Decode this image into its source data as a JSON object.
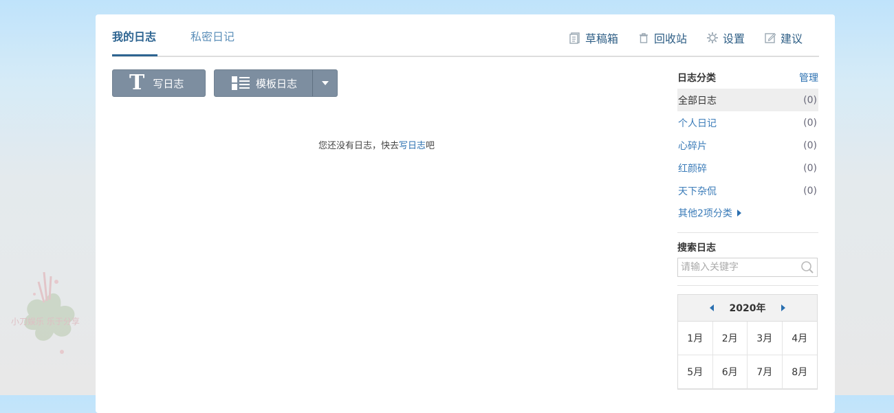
{
  "tabs": [
    {
      "label": "我的日志",
      "active": true
    },
    {
      "label": "私密日记",
      "active": false
    }
  ],
  "top_links": [
    {
      "label": "草稿箱",
      "icon": "draft-icon"
    },
    {
      "label": "回收站",
      "icon": "trash-icon"
    },
    {
      "label": "设置",
      "icon": "gear-icon"
    },
    {
      "label": "建议",
      "icon": "edit-icon"
    }
  ],
  "buttons": {
    "write_label": "写日志",
    "write_icon_glyph": "T",
    "template_label": "模板日志"
  },
  "empty": {
    "prefix": "您还没有日志，快去",
    "link": "写日志",
    "suffix": "吧"
  },
  "sidebar": {
    "categories_title": "日志分类",
    "manage_label": "管理",
    "categories": [
      {
        "name": "全部日志",
        "count": "(0)",
        "selected": true
      },
      {
        "name": "个人日记",
        "count": "(0)",
        "selected": false
      },
      {
        "name": "心碎片",
        "count": "(0)",
        "selected": false
      },
      {
        "name": "红颜碎",
        "count": "(0)",
        "selected": false
      },
      {
        "name": "天下杂侃",
        "count": "(0)",
        "selected": false
      }
    ],
    "more_label": "其他2项分类",
    "search_title": "搜索日志",
    "search_placeholder": "请输入关键字",
    "calendar": {
      "year": "2020年",
      "months": [
        "1月",
        "2月",
        "3月",
        "4月",
        "5月",
        "6月",
        "7月",
        "8月"
      ]
    }
  },
  "watermark": {
    "text": "小刀娱乐 乐于分享"
  },
  "colors": {
    "accent": "#2d6491",
    "link": "#3a7bb8",
    "button_bg": "#7d8ea0"
  }
}
